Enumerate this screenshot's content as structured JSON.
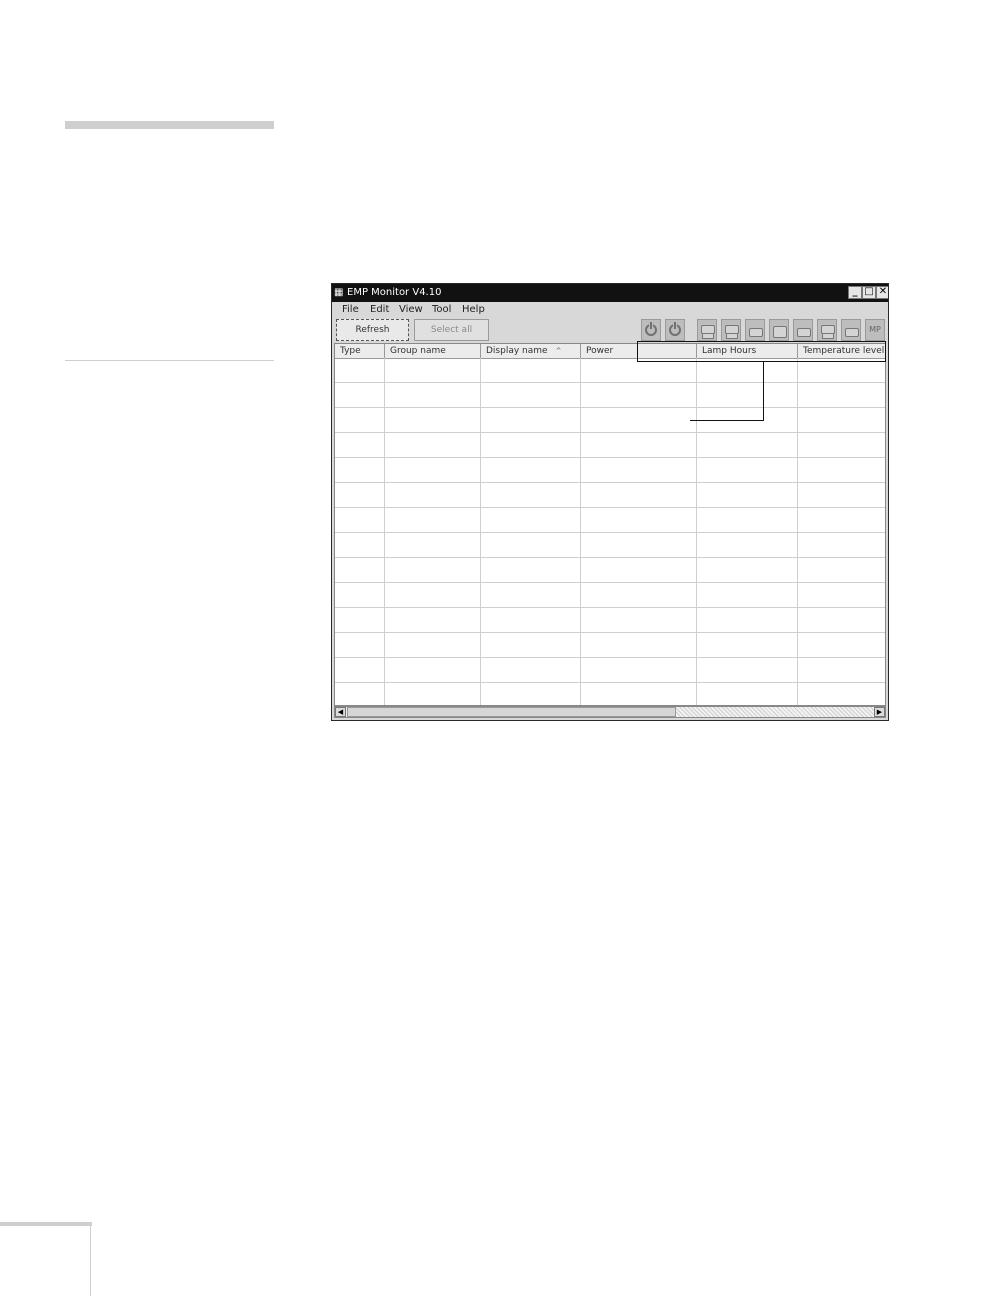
{
  "window": {
    "title": "EMP Monitor V4.10",
    "controls": {
      "minimize": "_",
      "maximize": "□",
      "close": "✕"
    }
  },
  "menu": [
    "File",
    "Edit",
    "View",
    "Tool",
    "Help"
  ],
  "toolbar": {
    "refresh_label": "Refresh",
    "select_all_label": "Select all",
    "last_tool_label": "MP",
    "icons": [
      "power-on-icon",
      "power-off-icon",
      "input-computer-icon",
      "input-component-icon",
      "input-video-icon",
      "input-svideo-icon",
      "input-dvi-icon",
      "input-hdmi-icon",
      "input-usb-icon",
      "input-mp-icon"
    ]
  },
  "columns": [
    "Type",
    "Group name",
    "Display name",
    "Power",
    "Lamp Hours",
    "Temperature level"
  ],
  "sort_indicator": "^",
  "scrollbar": {
    "left_arrow": "◀",
    "right_arrow": "▶"
  }
}
